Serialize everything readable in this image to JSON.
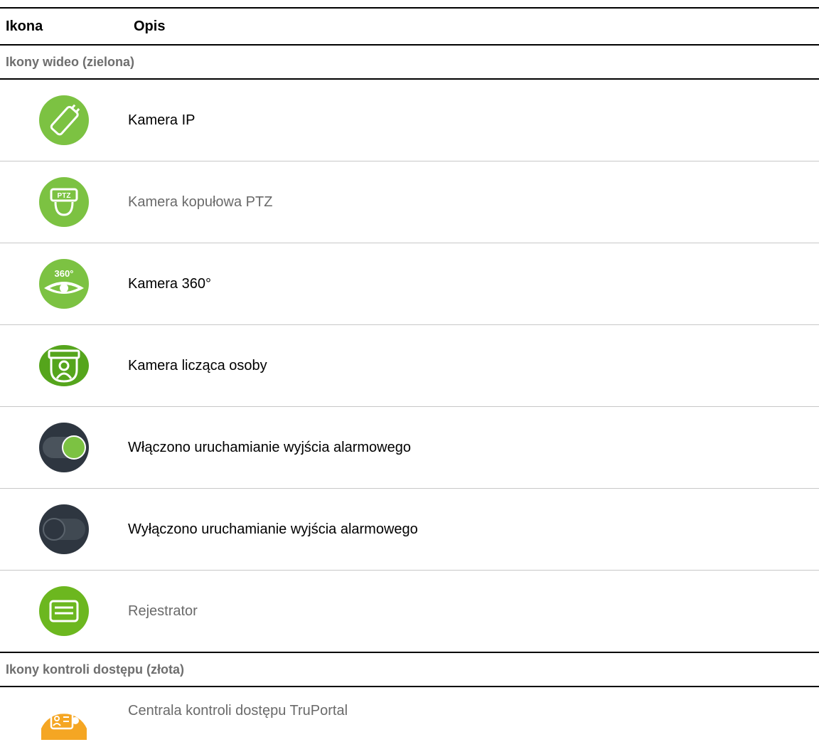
{
  "table": {
    "headers": {
      "icon": "Ikona",
      "description": "Opis"
    },
    "sections": [
      {
        "title": "Ikony wideo (zielona)",
        "rows": [
          {
            "icon": "ip-camera-icon",
            "label": "Kamera IP",
            "color": "#000000"
          },
          {
            "icon": "ptz-dome-camera-icon",
            "label": "Kamera kopułowa PTZ",
            "color": "#6a6a6a"
          },
          {
            "icon": "camera-360-icon",
            "label": "Kamera 360°",
            "color": "#000000"
          },
          {
            "icon": "people-counting-camera-icon",
            "label": "Kamera licząca osoby",
            "color": "#000000"
          },
          {
            "icon": "toggle-on-icon",
            "label": "Włączono uruchamianie wyjścia alarmowego",
            "color": "#000000"
          },
          {
            "icon": "toggle-off-icon",
            "label": "Wyłączono uruchamianie wyjścia alarmowego",
            "color": "#000000"
          },
          {
            "icon": "recorder-icon",
            "label": "Rejestrator",
            "color": "#6a6a6a"
          }
        ]
      },
      {
        "title": "Ikony kontroli dostępu (złota)",
        "rows": [
          {
            "icon": "truportal-controller-icon",
            "label": "Centrala kontroli dostępu TruPortal",
            "color": "#6a6a6a"
          }
        ]
      }
    ],
    "colors": {
      "video_green": "#7cc242",
      "access_gold": "#f5a623",
      "toggle_dark": "#2e3640"
    }
  }
}
